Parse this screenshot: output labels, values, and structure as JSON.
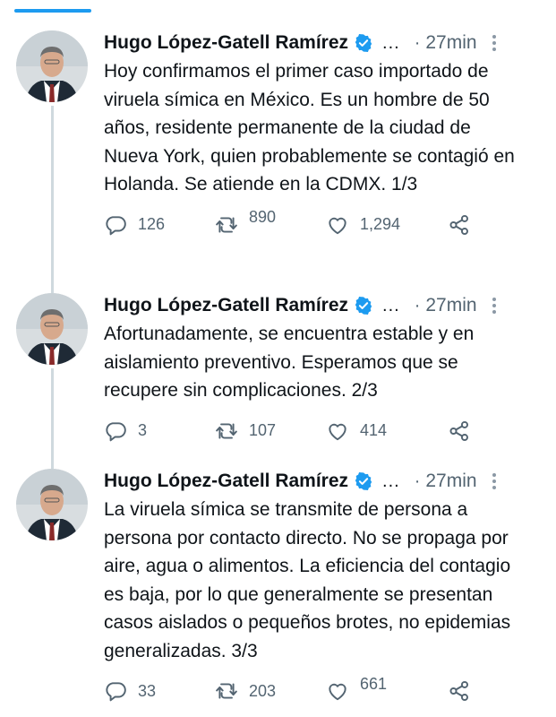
{
  "author": {
    "name": "Hugo López-Gatell Ramírez",
    "name_overflow": "...",
    "verified": true,
    "avatar": "avatar-photo"
  },
  "accent_color": "#1d9bf0",
  "tweets": [
    {
      "time": "27min",
      "separator": "·",
      "text": "Hoy confirmamos el primer caso importado de viruela símica en México. Es un hombre de 50 años, residente permanente de la ciudad de Nueva York, quien probablemente se contagió en Holanda. Se atiende en la CDMX. 1/3",
      "replies": "126",
      "retweets": "890",
      "likes": "1,294"
    },
    {
      "time": "27min",
      "separator": "·",
      "text": "Afortunadamente, se encuentra estable y en aislamiento preventivo. Esperamos que se recupere sin complicaciones. 2/3",
      "replies": "3",
      "retweets": "107",
      "likes": "414"
    },
    {
      "time": "27min",
      "separator": "·",
      "text": "La viruela símica se transmite de persona a persona por contacto directo. No se propaga por aire, agua o alimentos. La eficiencia del contagio es baja, por lo que generalmente se presentan casos aislados o pequeños brotes, no epidemias generalizadas. 3/3",
      "replies": "33",
      "retweets": "203",
      "likes": "661"
    }
  ],
  "icons": {
    "reply": "reply-icon",
    "retweet": "retweet-icon",
    "like": "heart-icon",
    "share": "share-icon",
    "more": "more-options-icon",
    "verified": "verified-badge-icon"
  }
}
